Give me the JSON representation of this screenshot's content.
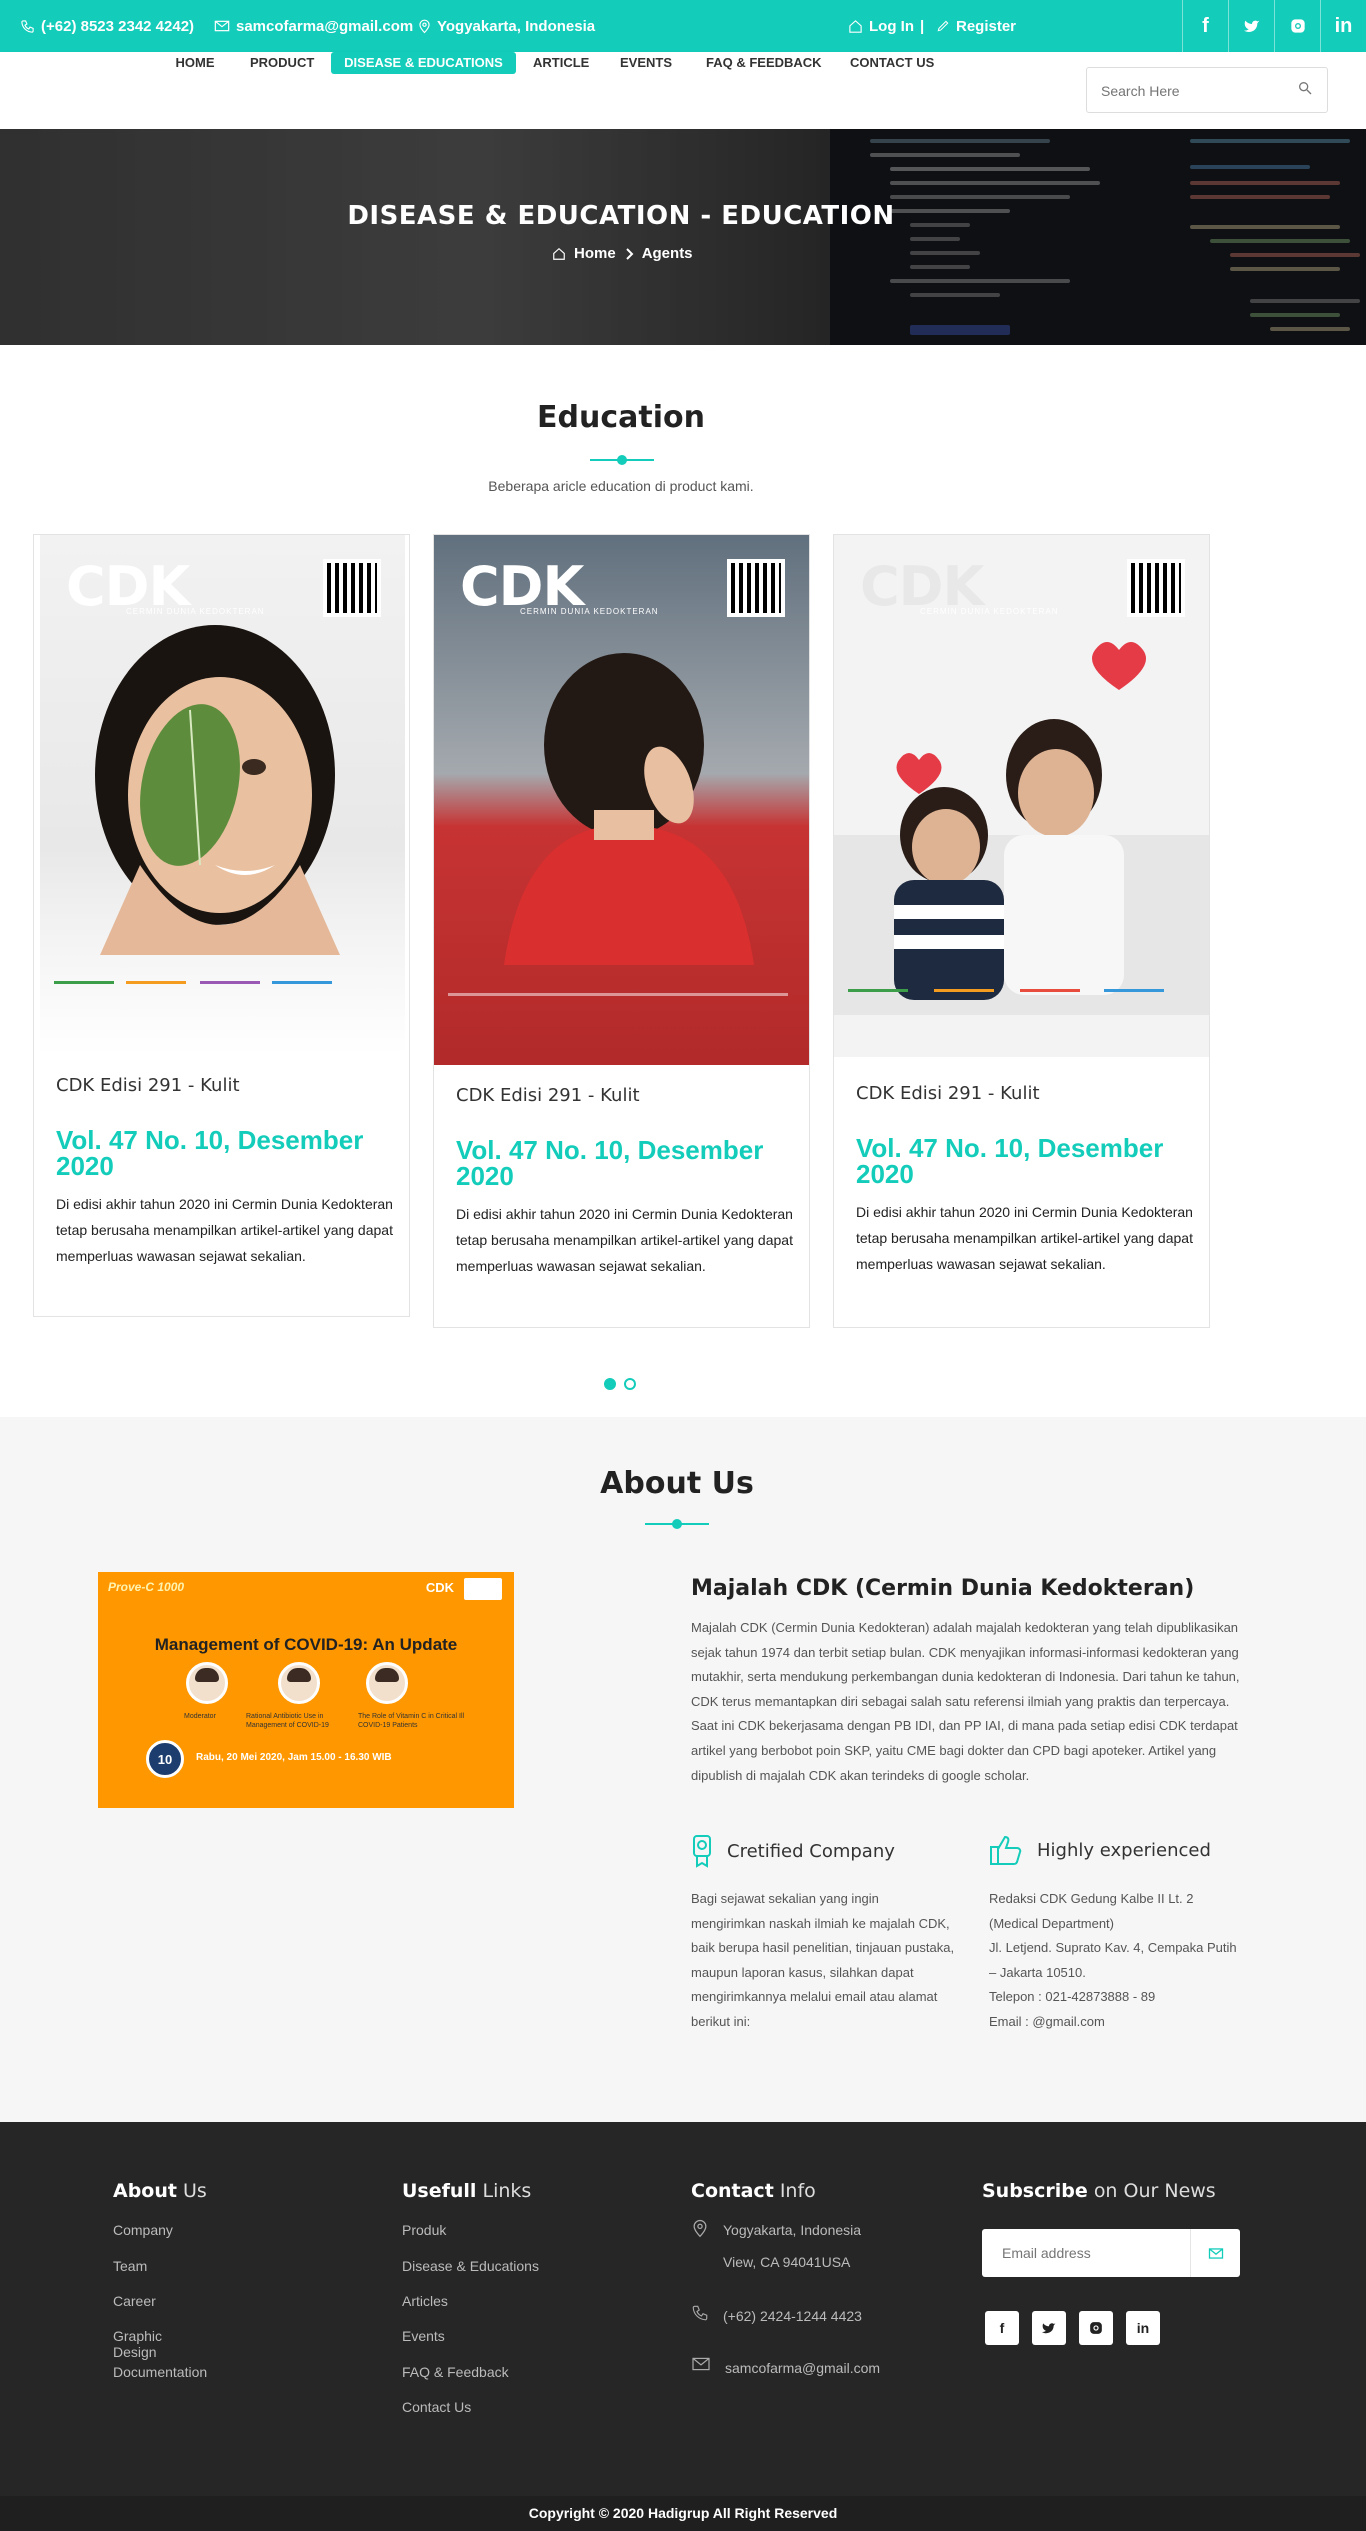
{
  "topbar": {
    "phone": "(+62) 8523 2342 4242)",
    "email": "samcofarma@gmail.com",
    "location": "Yogyakarta, Indonesia",
    "login": "Log In",
    "separator": "|",
    "register": "Register",
    "social": [
      "f",
      "y",
      "ig",
      "in"
    ]
  },
  "nav": {
    "items": [
      "HOME",
      "PRODUCT",
      "DISEASE & EDUCATIONS",
      "ARTICLE",
      "EVENTS",
      "FAQ & FEEDBACK",
      "CONTACT US"
    ],
    "active": "DISEASE & EDUCATIONS",
    "search_placeholder": "Search Here"
  },
  "hero": {
    "title": "DISEASE & EDUCATION - EDUCATION",
    "breadcrumb_home": "Home",
    "breadcrumb_current": "Agents"
  },
  "education": {
    "title": "Education",
    "subtitle": "Beberapa aricle education di product kami.",
    "cards": [
      {
        "cover_logo": "CDK",
        "cover_tag": "CERMIN DUNIA KEDOKTERAN",
        "title": "CDK Edisi 291 - Kulit",
        "volume": "Vol. 47 No. 10, Desember 2020",
        "description": "Di edisi akhir tahun 2020 ini Cermin Dunia Kedokteran tetap berusaha menampilkan artikel-artikel yang dapat memperluas wawasan sejawat sekalian."
      },
      {
        "cover_logo": "CDK",
        "cover_tag": "CERMIN DUNIA KEDOKTERAN",
        "title": "CDK Edisi 291 - Kulit",
        "volume": "Vol. 47 No. 10, Desember 2020",
        "description": "Di edisi akhir tahun 2020 ini Cermin Dunia Kedokteran tetap berusaha menampilkan artikel-artikel yang dapat memperluas wawasan sejawat sekalian."
      },
      {
        "cover_logo": "CDK",
        "cover_tag": "CERMIN DUNIA KEDOKTERAN",
        "title": "CDK Edisi 291 - Kulit",
        "volume": "Vol. 47 No. 10, Desember 2020",
        "description": "Di edisi akhir tahun 2020 ini Cermin Dunia Kedokteran tetap berusaha menampilkan artikel-artikel yang dapat memperluas wawasan sejawat sekalian."
      }
    ],
    "pagination": {
      "pages": 2,
      "current": 1
    }
  },
  "about": {
    "title": "About Us",
    "webinar": {
      "brand_left": "Prove-C 1000",
      "brand_right": "CDK",
      "title": "Management of COVID-19: An Update",
      "date": "Rabu, 20 Mei 2020, Jam 15.00 - 16.30 WIB",
      "badge": "10",
      "speakers": [
        "Moderator",
        "Rational Antibiotic Use in Management of COVID-19",
        "The Role of Vitamin C in Critical Ill COVID-19 Patients"
      ]
    },
    "heading": "Majalah CDK (Cermin Dunia Kedokteran)",
    "paragraph": "Majalah CDK (Cermin Dunia Kedokteran) adalah majalah kedokteran yang telah dipublikasikan sejak tahun 1974 dan terbit setiap bulan. CDK menyajikan informasi-informasi kedokteran yang mutakhir, serta mendukung perkembangan dunia kedokteran di Indonesia. Dari tahun ke tahun, CDK terus memantapkan diri sebagai salah satu referensi ilmiah yang praktis dan terpercaya. Saat ini CDK bekerjasama dengan PB IDI, dan PP IAI, di mana pada setiap edisi CDK terdapat artikel yang berbobot poin SKP, yaitu CME bagi dokter dan CPD bagi apoteker. Artikel yang dipublish di majalah CDK akan terindeks di google scholar.",
    "feature1": {
      "icon": "certificate-icon",
      "label": "Cretified Company",
      "text": "Bagi sejawat sekalian yang ingin mengirimkan naskah ilmiah ke majalah CDK, baik berupa hasil penelitian, tinjauan pustaka, maupun laporan kasus, silahkan dapat mengirimkannya melalui email atau alamat berikut ini:"
    },
    "feature2": {
      "icon": "thumbs-up-icon",
      "label": "Highly experienced",
      "lines": [
        "Redaksi CDK Gedung Kalbe II Lt. 2",
        "(Medical Department)",
        "Jl. Letjend. Suprato Kav. 4, Cempaka Putih",
        "– Jakarta 10510.",
        "Telepon : 021-42873888 - 89",
        "Email : @gmail.com"
      ]
    }
  },
  "footer": {
    "col1": {
      "bold": "About",
      "light": "Us",
      "links": [
        "Company",
        "Team",
        "Career",
        "Graphic Design",
        "Documentation"
      ]
    },
    "col2": {
      "bold": "Usefull",
      "light": "Links",
      "links": [
        "Produk",
        "Disease & Educations",
        "Articles",
        "Events",
        "FAQ & Feedback",
        "Contact Us"
      ]
    },
    "col3": {
      "bold": "Contact",
      "light": "Info",
      "address1": "Yogyakarta, Indonesia",
      "address2": "View, CA 94041USA",
      "phone": "(+62) 2424-1244 4423",
      "email": "samcofarma@gmail.com"
    },
    "col4": {
      "bold": "Subscribe",
      "light": "on Our News",
      "placeholder": "Email address",
      "social": [
        "f",
        "y",
        "ig",
        "in"
      ]
    },
    "copyright": "Copyright © 2020 Hadigrup All Right Reserved"
  },
  "colors": {
    "accent": "#13ccba",
    "footer": "#262626",
    "about_bg": "#f6f6f6"
  }
}
